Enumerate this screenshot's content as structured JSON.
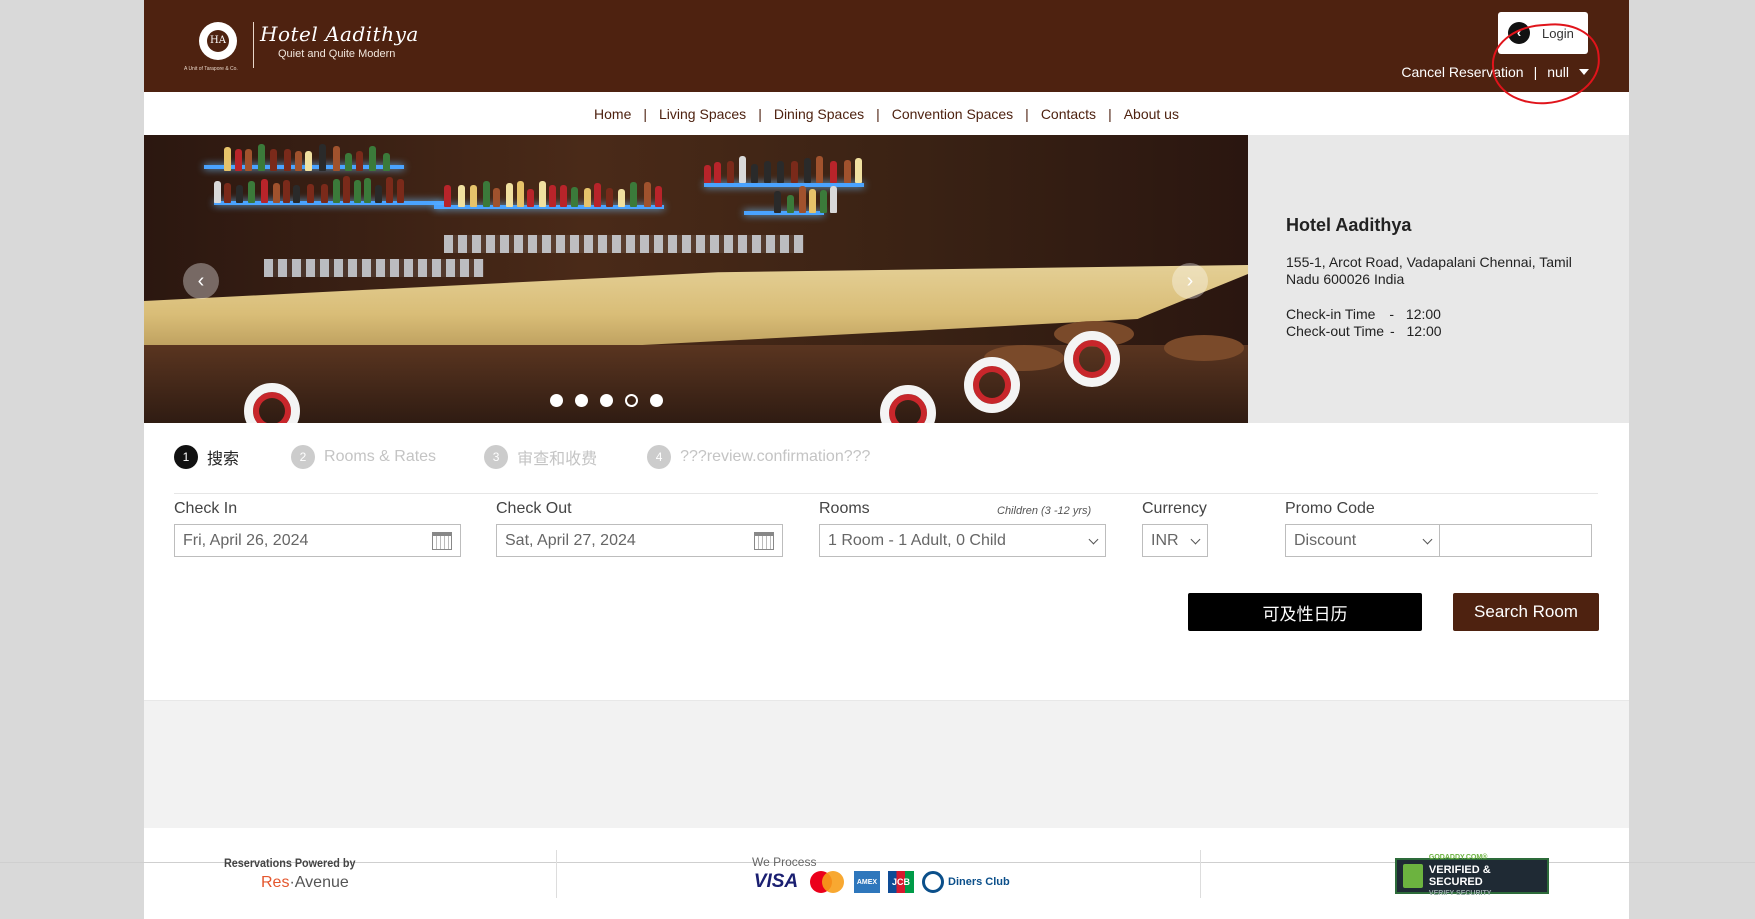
{
  "header": {
    "logo_seal": "HA",
    "logo_tagline": "A Unit of Tarapore & Co.",
    "hotel_name": "Hotel Aadithya",
    "hotel_slogan": "Quiet and Quite Modern",
    "login_icon": "chevron-left-icon",
    "login_arrow": "‹",
    "login_label": "Login",
    "cancel_reservation": "Cancel Reservation",
    "separator": "|",
    "user_value": "null",
    "annotation_color": "#e0141b"
  },
  "nav": {
    "items": [
      "Home",
      "Living Spaces",
      "Dining Spaces",
      "Convention Spaces",
      "Contacts",
      "About us"
    ],
    "separator": "|"
  },
  "hero": {
    "prev": "‹",
    "next": "›",
    "slide_count": 5,
    "active_slide": 4
  },
  "info": {
    "name": "Hotel Aadithya",
    "address": "155-1, Arcot Road, Vadapalani Chennai, Tamil Nadu 600026 India",
    "checkin_label": "Check-in Time",
    "checkin_value": "12:00",
    "checkout_label": "Check-out Time",
    "checkout_value": "12:00",
    "dash": "-"
  },
  "steps": [
    {
      "num": "1",
      "label": "搜索",
      "active": true
    },
    {
      "num": "2",
      "label": "Rooms & Rates",
      "active": false
    },
    {
      "num": "3",
      "label": "审查和收费",
      "active": false
    },
    {
      "num": "4",
      "label": "???review.confirmation???",
      "active": false
    }
  ],
  "form": {
    "checkin_label": "Check In",
    "checkin_value": "Fri, April 26, 2024",
    "checkout_label": "Check Out",
    "checkout_value": "Sat, April 27, 2024",
    "rooms_label": "Rooms",
    "children_note": "Children (3 -12 yrs)",
    "rooms_value": "1 Room - 1 Adult, 0 Child",
    "currency_label": "Currency",
    "currency_value": "INR",
    "promo_label": "Promo Code",
    "promo_type": "Discount",
    "promo_value": "",
    "availability_button": "可及性日历",
    "search_button": "Search Room"
  },
  "colors": {
    "brand_brown": "#4e2210",
    "info_panel": "#e8e8e8"
  },
  "footer": {
    "powered_label": "Reservations Powered by",
    "res": "Res",
    "avenue": "Avenue",
    "we_process": "We Process",
    "visa": "VISA",
    "amex": "AMEX",
    "jcb": "JCB",
    "diners": "Diners Club",
    "verified_top": "GODADDY.COM®",
    "verified_main": "VERIFIED & SECURED",
    "verified_sub": "VERIFY SECURITY"
  }
}
